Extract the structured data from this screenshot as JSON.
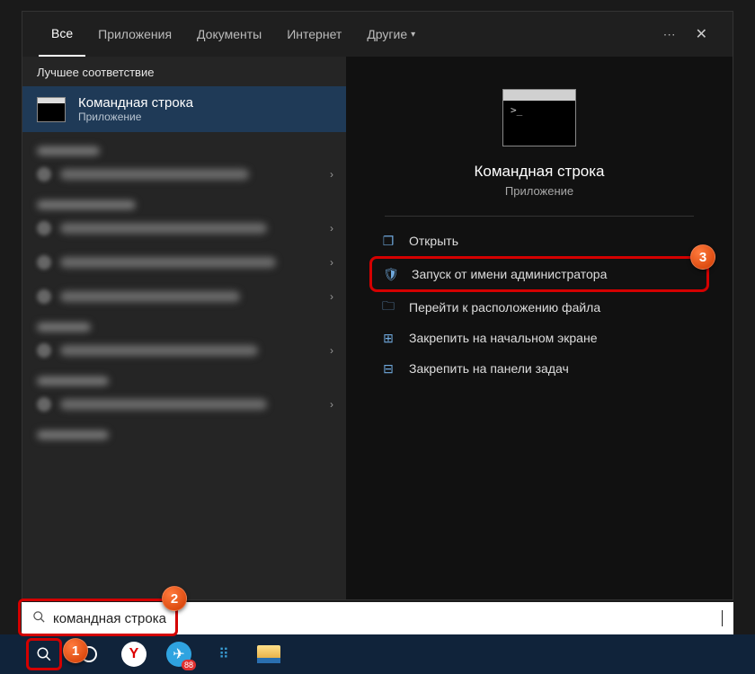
{
  "tabs": {
    "all": "Все",
    "apps": "Приложения",
    "docs": "Документы",
    "web": "Интернет",
    "more": "Другие"
  },
  "section": {
    "best_match": "Лучшее соответствие"
  },
  "best": {
    "title": "Командная строка",
    "sub": "Приложение"
  },
  "preview": {
    "title": "Командная строка",
    "sub": "Приложение"
  },
  "actions": {
    "open": "Открыть",
    "run_admin": "Запуск от имени администратора",
    "open_loc": "Перейти к расположению файла",
    "pin_start": "Закрепить на начальном экране",
    "pin_task": "Закрепить на панели задач"
  },
  "search": {
    "value": "командная строка"
  },
  "badges": {
    "b1": "1",
    "b2": "2",
    "b3": "3"
  },
  "taskbar": {
    "tg_badge": "88"
  }
}
